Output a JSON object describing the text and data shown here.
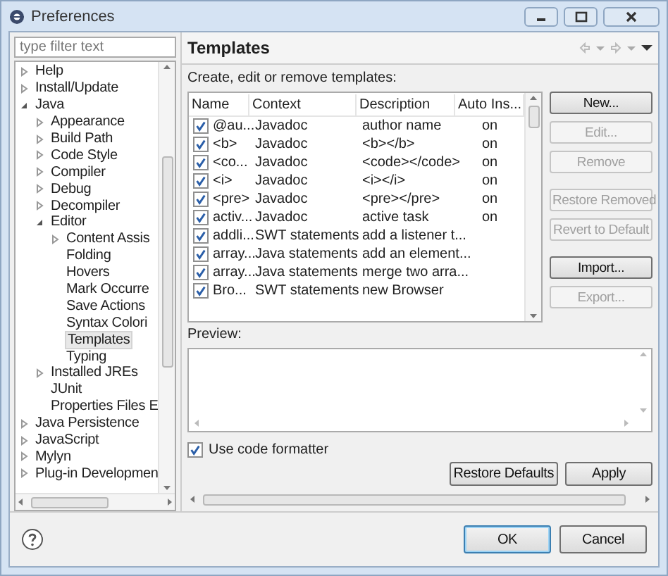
{
  "window": {
    "title": "Preferences"
  },
  "filter": {
    "placeholder": "type filter text"
  },
  "tree": [
    {
      "label": "Help",
      "expanded": false,
      "selected": false
    },
    {
      "label": "Install/Update",
      "expanded": false,
      "selected": false
    },
    {
      "label": "Java",
      "expanded": true,
      "selected": false,
      "children": [
        {
          "label": "Appearance",
          "expanded": false,
          "selected": false
        },
        {
          "label": "Build Path",
          "expanded": false,
          "selected": false
        },
        {
          "label": "Code Style",
          "expanded": false,
          "selected": false
        },
        {
          "label": "Compiler",
          "expanded": false,
          "selected": false
        },
        {
          "label": "Debug",
          "expanded": false,
          "selected": false
        },
        {
          "label": "Decompiler",
          "expanded": false,
          "selected": false
        },
        {
          "label": "Editor",
          "expanded": true,
          "selected": false,
          "children": [
            {
              "label": "Content Assis",
              "expanded": false,
              "selected": false
            },
            {
              "label": "Folding",
              "selected": false
            },
            {
              "label": "Hovers",
              "selected": false
            },
            {
              "label": "Mark Occurre",
              "selected": false
            },
            {
              "label": "Save Actions",
              "selected": false
            },
            {
              "label": "Syntax Colori",
              "selected": false
            },
            {
              "label": "Templates",
              "selected": true
            },
            {
              "label": "Typing",
              "selected": false
            }
          ]
        },
        {
          "label": "Installed JREs",
          "expanded": false,
          "selected": false
        },
        {
          "label": "JUnit",
          "selected": false
        },
        {
          "label": "Properties Files E",
          "selected": false
        }
      ]
    },
    {
      "label": "Java Persistence",
      "expanded": false,
      "selected": false
    },
    {
      "label": "JavaScript",
      "expanded": false,
      "selected": false
    },
    {
      "label": "Mylyn",
      "expanded": false,
      "selected": false
    },
    {
      "label": "Plug-in Developmen",
      "expanded": false,
      "selected": false
    }
  ],
  "page": {
    "title": "Templates",
    "description": "Create, edit or remove templates:"
  },
  "table": {
    "columns": [
      "Name",
      "Context",
      "Description",
      "Auto Ins..."
    ],
    "rows": [
      {
        "checked": true,
        "cells": [
          "@au...",
          "Javadoc",
          "author name",
          "on"
        ]
      },
      {
        "checked": true,
        "cells": [
          "<b>",
          "Javadoc",
          "<b></b>",
          "on"
        ]
      },
      {
        "checked": true,
        "cells": [
          "<co...",
          "Javadoc",
          "<code></code>",
          "on"
        ]
      },
      {
        "checked": true,
        "cells": [
          "<i>",
          "Javadoc",
          "<i></i>",
          "on"
        ]
      },
      {
        "checked": true,
        "cells": [
          "<pre>",
          "Javadoc",
          "<pre></pre>",
          "on"
        ]
      },
      {
        "checked": true,
        "cells": [
          "activ...",
          "Javadoc",
          "active task",
          "on"
        ]
      },
      {
        "checked": true,
        "cells": [
          "addli...",
          "SWT statements",
          "add a listener t...",
          ""
        ]
      },
      {
        "checked": true,
        "cells": [
          "array...",
          "Java statements",
          "add an element...",
          ""
        ]
      },
      {
        "checked": true,
        "cells": [
          "array...",
          "Java statements",
          "merge two arra...",
          ""
        ]
      },
      {
        "checked": true,
        "cells": [
          "Bro...",
          "SWT statements",
          "new Browser",
          ""
        ]
      }
    ]
  },
  "side_buttons": [
    {
      "label": "New...",
      "disabled": false
    },
    {
      "label": "Edit...",
      "disabled": true
    },
    {
      "label": "Remove",
      "disabled": true
    },
    {
      "label": "Restore Removed",
      "disabled": true
    },
    {
      "label": "Revert to Default",
      "disabled": true
    },
    {
      "label": "Import...",
      "disabled": false
    },
    {
      "label": "Export...",
      "disabled": true
    }
  ],
  "preview": {
    "label": "Preview:"
  },
  "formatter": {
    "label": "Use code formatter",
    "checked": true
  },
  "page_buttons": [
    "Restore Defaults",
    "Apply"
  ],
  "dialog_buttons": [
    "OK",
    "Cancel"
  ]
}
